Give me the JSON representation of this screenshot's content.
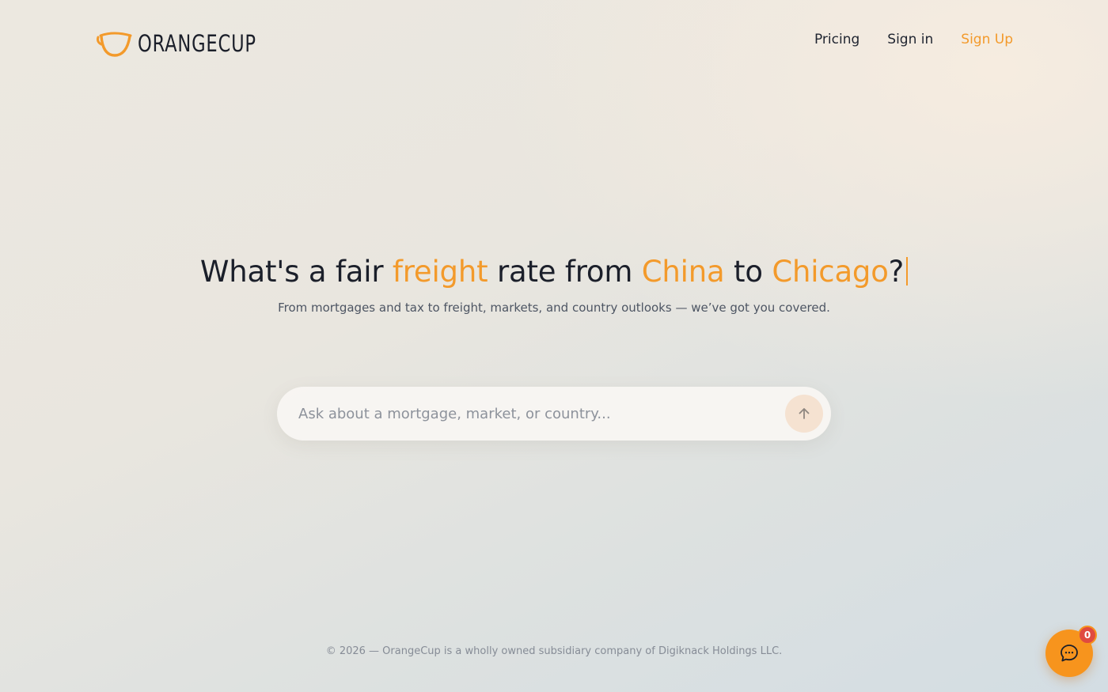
{
  "brand": {
    "name": "ORANGECUP",
    "accent_color": "#f39a2b"
  },
  "nav": {
    "pricing": "Pricing",
    "sign_in": "Sign in",
    "sign_up": "Sign Up"
  },
  "hero": {
    "headline": {
      "part1": "What's a fair ",
      "word1": "freight",
      "part2": " rate from ",
      "word2": "China",
      "part3": " to ",
      "word3": "Chicago",
      "part4": "?"
    },
    "subtitle": "From mortgages and tax to freight, markets, and country outlooks — we’ve got you covered."
  },
  "search": {
    "placeholder": "Ask about a mortgage, market, or country...",
    "value": "",
    "submit_icon": "arrow-up-icon"
  },
  "footer": {
    "text": "© 2026 — OrangeCup is a wholly owned subsidiary company of Digiknack Holdings LLC."
  },
  "chat": {
    "icon": "chat-bubble-icon",
    "unread_count": "0",
    "color": "#f7941d"
  }
}
